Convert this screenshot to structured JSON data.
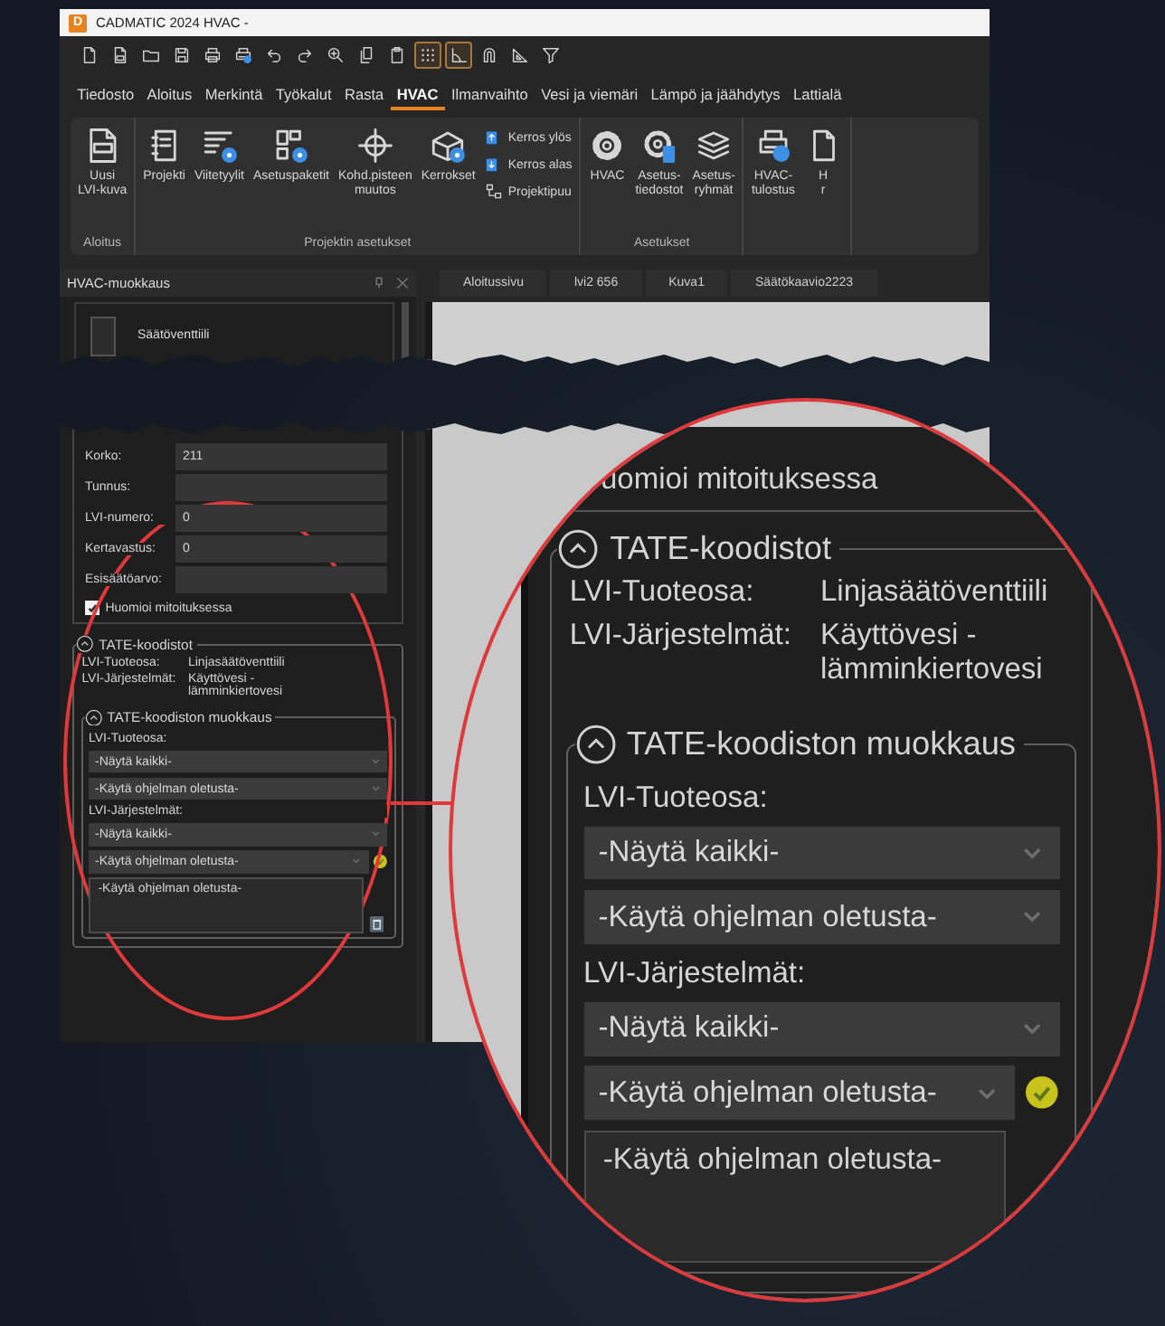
{
  "window": {
    "logo": "D",
    "title": "CADMATIC 2024 HVAC -"
  },
  "quick_toolbar": [
    {
      "kind": "file",
      "on": false
    },
    {
      "kind": "code-file",
      "on": false
    },
    {
      "kind": "folder",
      "on": false
    },
    {
      "kind": "save",
      "on": false
    },
    {
      "kind": "printer",
      "on": false
    },
    {
      "kind": "printer-globe",
      "on": false
    },
    {
      "kind": "undo",
      "on": false
    },
    {
      "kind": "redo",
      "on": false
    },
    {
      "kind": "zoom",
      "on": false
    },
    {
      "kind": "copy",
      "on": false
    },
    {
      "kind": "paste",
      "on": false
    },
    {
      "kind": "grid",
      "on": true
    },
    {
      "kind": "angle",
      "on": true
    },
    {
      "kind": "magnet",
      "on": false
    },
    {
      "kind": "set-square",
      "on": false
    },
    {
      "kind": "filter",
      "on": false
    }
  ],
  "menu": [
    {
      "label": "Tiedosto",
      "selected": false
    },
    {
      "label": "Aloitus",
      "selected": false
    },
    {
      "label": "Merkintä",
      "selected": false
    },
    {
      "label": "Työkalut",
      "selected": false
    },
    {
      "label": "Rasta",
      "selected": false
    },
    {
      "label": "HVAC",
      "selected": true
    },
    {
      "label": "Ilmanvaihto",
      "selected": false
    },
    {
      "label": "Vesi ja viemäri",
      "selected": false
    },
    {
      "label": "Lämpö ja jäähdytys",
      "selected": false
    },
    {
      "label": "Lattialä",
      "selected": false
    }
  ],
  "ribbon": [
    {
      "label": "Aloitus",
      "buttons": [
        {
          "kind": "large",
          "label": "Uusi\nLVI-kuva"
        }
      ]
    },
    {
      "label": "Projektin asetukset",
      "buttons": [
        {
          "kind": "large",
          "label": "Projekti"
        },
        {
          "kind": "large",
          "label": "Viitetyylit"
        },
        {
          "kind": "large",
          "label": "Asetuspaketit"
        },
        {
          "kind": "large",
          "label": "Kohd.pisteen\nmuutos"
        },
        {
          "kind": "large",
          "label": "Kerrokset"
        },
        {
          "kind": "small",
          "label": "Kerros ylös"
        },
        {
          "kind": "small",
          "label": "Kerros alas"
        },
        {
          "kind": "small",
          "label": "Projektipuu"
        }
      ]
    },
    {
      "label": "Asetukset",
      "buttons": [
        {
          "kind": "large",
          "label": "HVAC"
        },
        {
          "kind": "large",
          "label": "Asetus-\ntiedostot"
        },
        {
          "kind": "large",
          "label": "Asetus-\nryhmät"
        }
      ]
    },
    {
      "buttons": [
        {
          "kind": "large",
          "label": "HVAC-\ntulostus"
        },
        {
          "kind": "large",
          "label": "H\nr"
        }
      ]
    }
  ],
  "doc_tabs": [
    {
      "label": "Aloitussivu"
    },
    {
      "label": "lvi2 656"
    },
    {
      "label": "Kuva1"
    },
    {
      "label": "Säätökaavio2223"
    }
  ],
  "side_panel": {
    "title": "HVAC-muokkaus",
    "item": "Säätöventtiili",
    "fields": [
      {
        "label": "Korko:",
        "value": "211"
      },
      {
        "label": "Tunnus:"
      },
      {
        "label": "LVI-numero:",
        "value": "0"
      },
      {
        "label": "Kertavastus:",
        "value": "0"
      },
      {
        "label": "Esisäätöarvo:"
      }
    ],
    "checkbox": {
      "label": "Huomioi mitoituksessa",
      "checked": true
    },
    "codes": {
      "title": "TATE-koodistot",
      "expanded": true,
      "rows": [
        {
          "label": "LVI-Tuoteosa:",
          "value": "Linjasäätöventtiili"
        },
        {
          "label": "LVI-Järjestelmät:",
          "value": "Käyttövesi - lämminkiertovesi"
        }
      ]
    },
    "code_edit": {
      "title": "TATE-koodiston muokkaus",
      "expanded": true,
      "sections": [
        {
          "label": "LVI-Tuoteosa:",
          "dropdowns": [
            {
              "kind": "plain",
              "value": "-Näytä kaikki-"
            },
            {
              "kind": "plain",
              "value": "-Käytä ohjelman oletusta-"
            }
          ]
        },
        {
          "label": "LVI-Järjestelmät:",
          "dropdowns": [
            {
              "kind": "plain",
              "value": "-Näytä kaikki-"
            },
            {
              "kind": "with-action",
              "value": "-Käytä ohjelman oletusta-"
            }
          ]
        }
      ],
      "list_box": {
        "value": "-Käytä ohjelman oletusta-"
      }
    }
  },
  "magnifier": {
    "checkbox": {
      "label": "uomioi mitoituksessa"
    },
    "codes": {
      "title": "TATE-koodistot",
      "expanded": true,
      "rows": [
        {
          "label": "LVI-Tuoteosa:",
          "value": "Linjasäätöventtiili"
        },
        {
          "label": "LVI-Järjestelmät:",
          "value": "Käyttövesi - lämminkiertovesi"
        }
      ]
    },
    "code_edit": {
      "title": "TATE-koodiston muokkaus",
      "expanded": true,
      "sections": [
        {
          "label": "LVI-Tuoteosa:",
          "dropdowns": [
            {
              "kind": "plain",
              "value": "-Näytä kaikki-"
            },
            {
              "kind": "plain",
              "value": "-Käytä ohjelman oletusta-"
            }
          ]
        },
        {
          "label": "LVI-Järjestelmät:",
          "dropdowns": [
            {
              "kind": "plain",
              "value": "-Näytä kaikki-"
            },
            {
              "kind": "with-action",
              "value": "-Käytä ohjelman oletusta-"
            }
          ]
        }
      ],
      "list_box": {
        "value": "-Käytä ohjelman oletusta-"
      }
    }
  }
}
